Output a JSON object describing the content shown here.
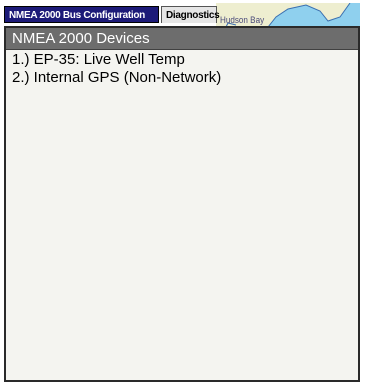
{
  "tabs": [
    {
      "label": "NMEA 2000 Bus Configuration",
      "active": true
    },
    {
      "label": "Diagnostics",
      "active": false
    }
  ],
  "map": {
    "label": "Hudson Bay"
  },
  "panel": {
    "title": "NMEA 2000 Devices",
    "devices": [
      {
        "label": "1.) EP-35: Live Well Temp"
      },
      {
        "label": "2.) Internal GPS (Non-Network)"
      }
    ]
  },
  "colors": {
    "active_tab": "#1c1a78",
    "panel_header": "#6d6d6d",
    "panel_bg": "#f4f4f0",
    "map_land": "#eeeed0",
    "map_water": "#8fd0ee"
  }
}
